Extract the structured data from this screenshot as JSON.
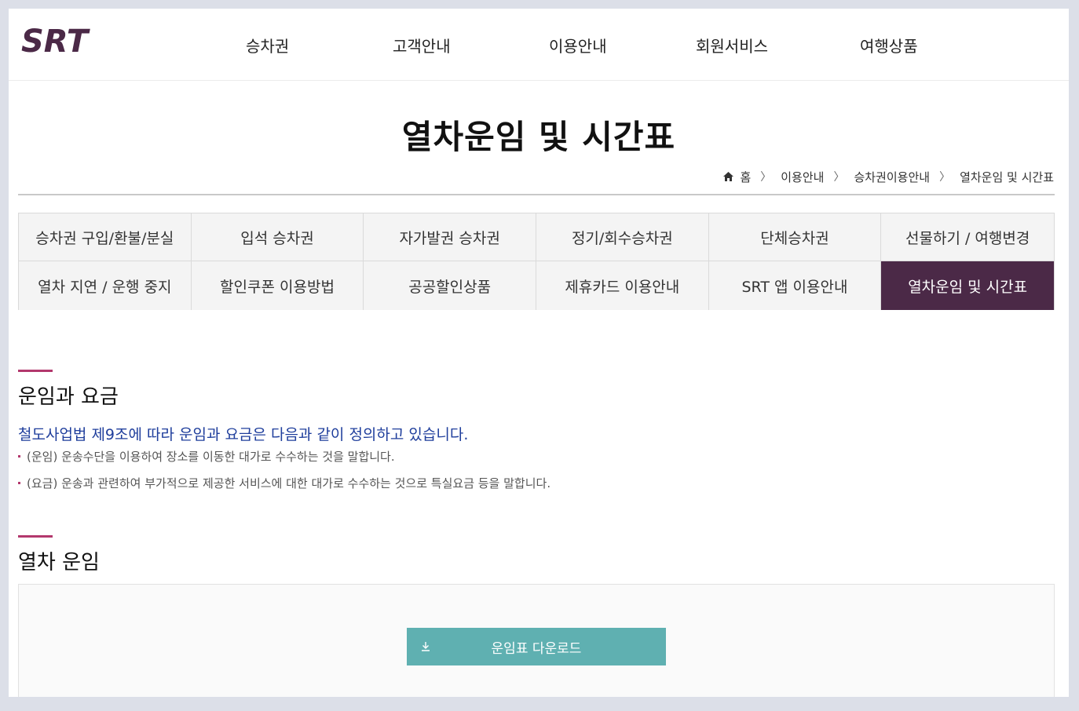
{
  "brand": {
    "logo_text": "SRT",
    "color": "#4b2947"
  },
  "gnb": [
    "승차권",
    "고객안내",
    "이용안내",
    "회원서비스",
    "여행상품"
  ],
  "page": {
    "title": "열차운임 및 시간표"
  },
  "breadcrumb": {
    "home": "홈",
    "items": [
      "이용안내",
      "승차권이용안내",
      "열차운임 및 시간표"
    ]
  },
  "tabs": [
    "승차권 구입/환불/분실",
    "입석 승차권",
    "자가발권 승차권",
    "정기/회수승차권",
    "단체승차권",
    "선물하기 / 여행변경",
    "열차 지연 / 운행 중지",
    "할인쿠폰 이용방법",
    "공공할인상품",
    "제휴카드 이용안내",
    "SRT 앱 이용안내",
    "열차운임 및 시간표"
  ],
  "active_tab": "열차운임 및 시간표",
  "section1": {
    "title": "운임과 요금",
    "lead": "철도사업법 제9조에 따라 운임과 요금은 다음과 같이 정의하고 있습니다.",
    "bullets": [
      "(운임) 운송수단을 이용하여 장소를 이동한 대가로 수수하는 것을 말합니다.",
      "(요금) 운송과 관련하여 부가적으로 제공한 서비스에 대한 대가로 수수하는 것으로 특실요금 등을 말합니다."
    ]
  },
  "section2": {
    "title": "열차 운임",
    "download_label": "운임표 다운로드"
  },
  "colors": {
    "accent": "#b3386d",
    "lead_text": "#1f3e9c",
    "download_button": "#5fb0b1"
  }
}
